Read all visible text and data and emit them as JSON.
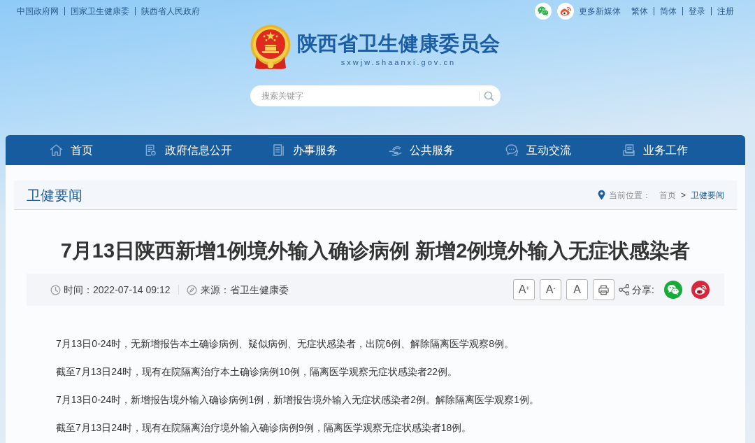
{
  "top_bar": {
    "links": [
      "中国政府网",
      "国家卫生健康委",
      "陕西省人民政府"
    ],
    "more_media": "更多新媒体",
    "account_links": [
      "繁体",
      "简体",
      "登录",
      "注册"
    ]
  },
  "header": {
    "site_title": "陕西省卫生健康委员会",
    "domain": "sxwjw.shaanxi.gov.cn",
    "search": {
      "placeholder": "搜索关键字"
    }
  },
  "nav": {
    "items": [
      "首页",
      "政府信息公开",
      "办事服务",
      "公共服务",
      "互动交流",
      "业务工作"
    ]
  },
  "section": {
    "title": "卫健要闻",
    "breadcrumb": {
      "label": "当前位置：",
      "separator": ">",
      "items": [
        {
          "text": "首页",
          "current": false
        },
        {
          "text": "卫健要闻",
          "current": true
        }
      ]
    }
  },
  "article": {
    "title": "7月13日陕西新增1例境外输入确诊病例 新增2例境外输入无症状感染者",
    "meta": {
      "time": "时间：2022-07-14 09:12",
      "source": "来源：省卫生健康委"
    },
    "tools": {
      "font_buttons": [
        "A$^{+}$",
        "A$^{-}$",
        "A"
      ],
      "share_label": "分享:"
    },
    "paragraphs": [
      "7月13日0-24时，无新增报告本土确诊病例、疑似病例、无症状感染者，出院6例、解除隔离医学观察8例。",
      "截至7月13日24时，现有在院隔离治疗本土确诊病例10例，隔离医学观察无症状感染者22例。",
      "7月13日0-24时，新增报告境外输入确诊病例1例，新增报告境外输入无症状感染者2例。解除隔离医学观察1例。",
      "截至7月13日24时，现有在院隔离治疗境外输入确诊病例9例，隔离医学观察无症状感染者18例。"
    ]
  }
}
